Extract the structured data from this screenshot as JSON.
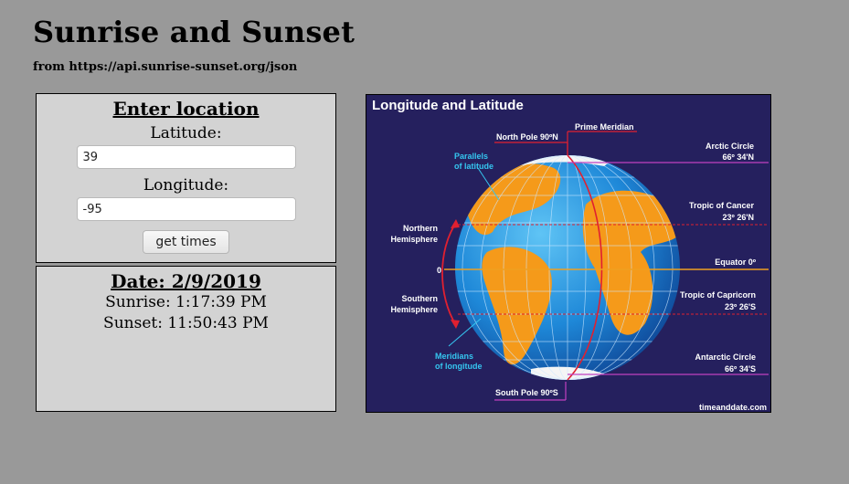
{
  "header": {
    "title": "Sunrise and Sunset",
    "subtitle": "from https://api.sunrise-sunset.org/json"
  },
  "location_form": {
    "heading": "Enter location",
    "latitude_label": "Latitude:",
    "latitude_value": "39",
    "longitude_label": "Longitude:",
    "longitude_value": "-95",
    "submit_label": "get times"
  },
  "results": {
    "date_heading": "Date: 2/9/2019",
    "sunrise": "Sunrise: 1:17:39 PM",
    "sunset": "Sunset: 11:50:43 PM"
  },
  "globe_diagram": {
    "title": "Longitude and Latitude",
    "prime_meridian": "Prime Meridian",
    "north_pole": "North Pole 90ºN",
    "parallels_1": "Parallels",
    "parallels_2": "of latitude",
    "arctic_1": "Arctic Circle",
    "arctic_2": "66º 34'N",
    "cancer_1": "Tropic of Cancer",
    "cancer_2": "23º 26'N",
    "northern_1": "Northern",
    "northern_2": "Hemisphere",
    "equator": "Equator 0º",
    "zero": "0",
    "southern_1": "Southern",
    "southern_2": "Hemisphere",
    "capricorn_1": "Tropic of Capricorn",
    "capricorn_2": "23º 26'S",
    "meridians_1": "Meridians",
    "meridians_2": "of longitude",
    "antarctic_1": "Antarctic Circle",
    "antarctic_2": "66º 34'S",
    "south_pole": "South Pole 90ºS",
    "credit": "timeanddate.com",
    "colors": {
      "background": "#25205e",
      "ocean": "#1e88d8",
      "land": "#f59a1a",
      "meridian_line": "#e02030",
      "circle_line": "#c040c0",
      "equator_line": "#f0a020",
      "callout_text": "#35c6f0"
    }
  }
}
